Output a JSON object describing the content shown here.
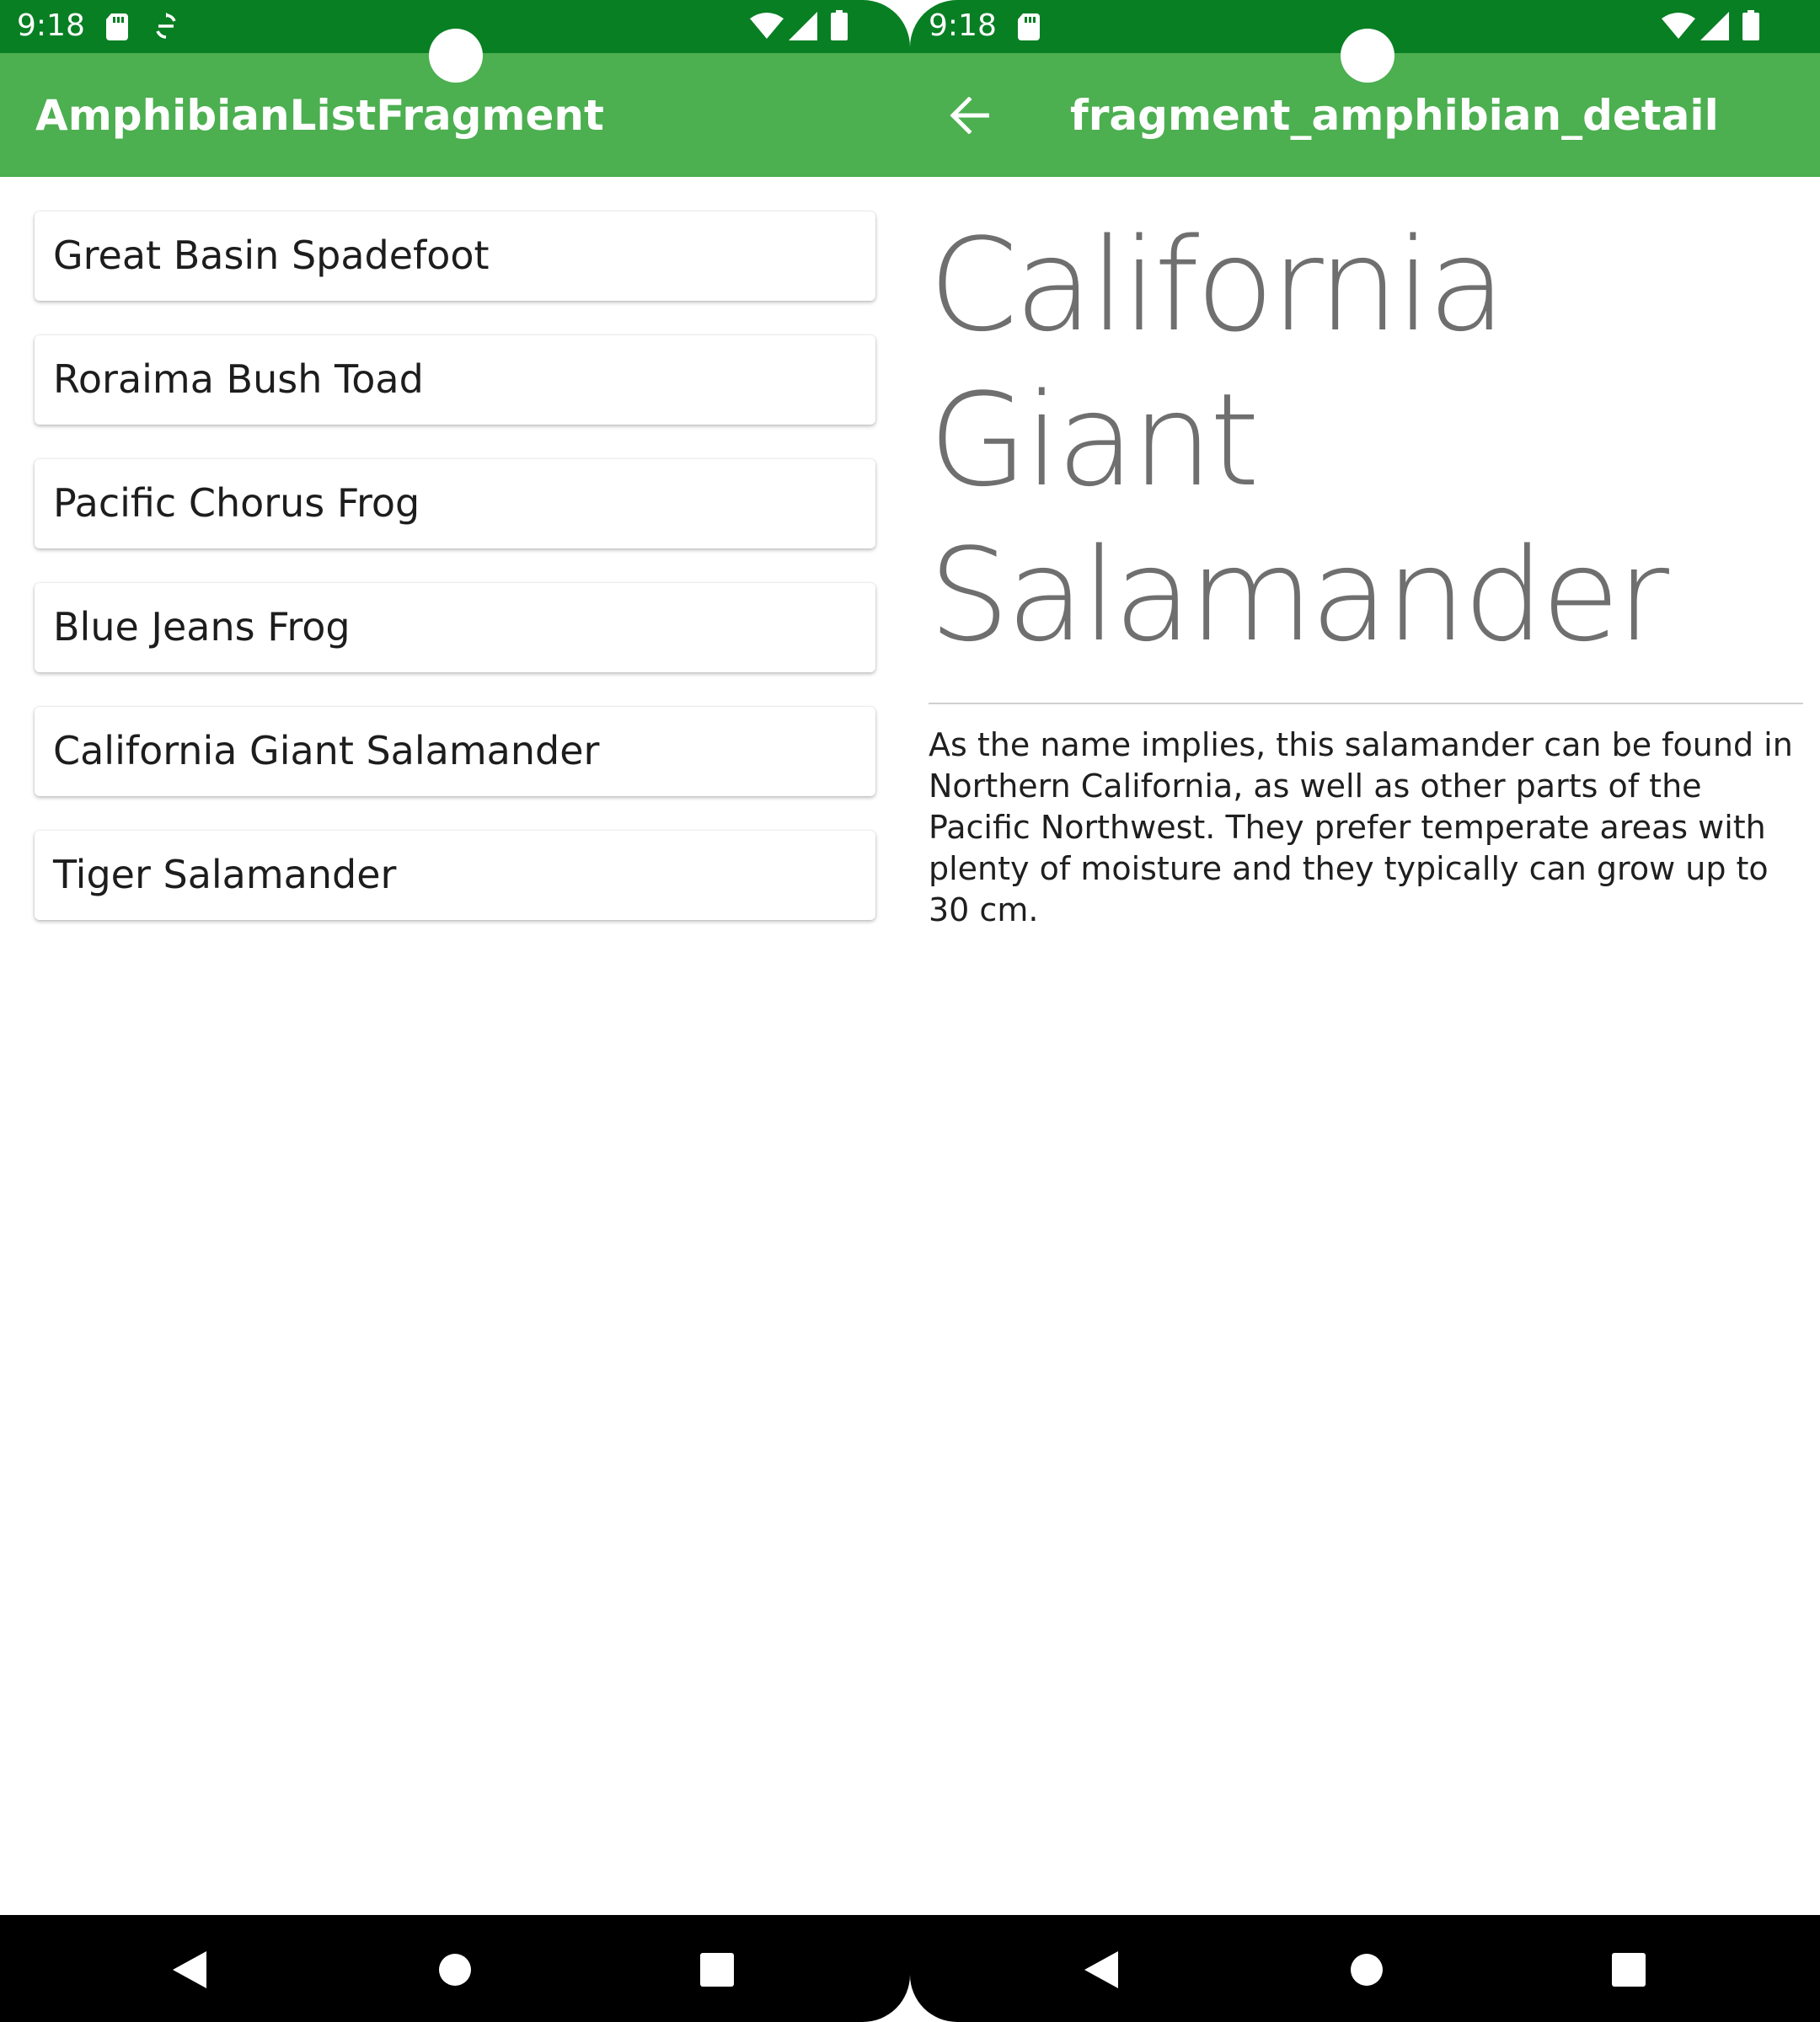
{
  "colors": {
    "status_bar": "#087f23",
    "app_bar": "#4caf50",
    "nav_bar": "#000000",
    "list_text": "#1d1d1d",
    "detail_title": "#6f6f6f"
  },
  "left_screen": {
    "status": {
      "time": "9:18",
      "icons": [
        "sd-card-icon",
        "sync-icon",
        "wifi-icon",
        "signal-icon",
        "battery-icon"
      ]
    },
    "app_bar": {
      "title": "AmphibianListFragment"
    },
    "list": {
      "items": [
        {
          "label": "Great Basin Spadefoot"
        },
        {
          "label": "Roraima Bush Toad"
        },
        {
          "label": "Pacific Chorus Frog"
        },
        {
          "label": "Blue Jeans Frog"
        },
        {
          "label": "California Giant Salamander"
        },
        {
          "label": "Tiger Salamander"
        }
      ]
    },
    "nav": {
      "buttons": [
        "back-icon",
        "home-icon",
        "recents-icon"
      ]
    }
  },
  "right_screen": {
    "status": {
      "time": "9:18",
      "icons": [
        "sd-card-icon",
        "wifi-icon",
        "signal-icon",
        "battery-icon"
      ]
    },
    "app_bar": {
      "title": "fragment_amphibian_detail",
      "nav_icon": "arrow-back-icon"
    },
    "detail": {
      "name": "California Giant Salamander",
      "description": "As the name implies, this salamander can be found in Northern California, as well as other parts of the Pacific Northwest. They prefer temperate areas with plenty of moisture and they typically can grow up to 30 cm."
    },
    "nav": {
      "buttons": [
        "back-icon",
        "home-icon",
        "recents-icon"
      ]
    }
  }
}
